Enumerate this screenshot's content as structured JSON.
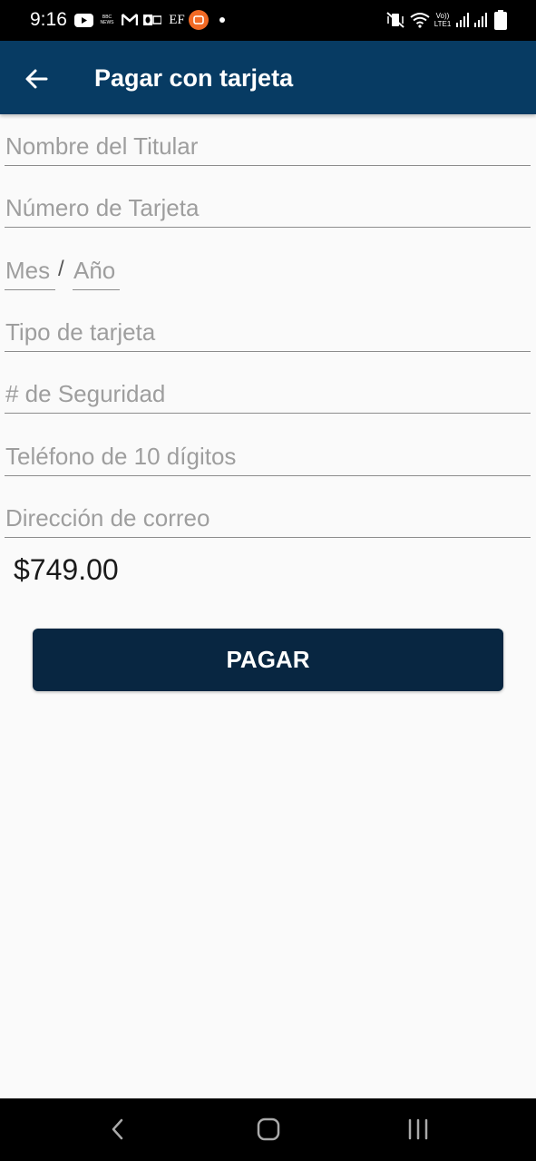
{
  "status_bar": {
    "time": "9:16",
    "icons": [
      "youtube-icon",
      "bbc-news-icon",
      "gmail-icon",
      "outlook-icon",
      "ef-icon",
      "app-notification-icon",
      "more-notifications-dot",
      "vibrate-mute-icon",
      "wifi-icon",
      "volte-icon",
      "signal-icon",
      "signal-icon-2",
      "battery-icon"
    ],
    "news_label": "BBC NEWS",
    "ef_label": "EF",
    "volte_label": "Vo)) LTE1",
    "battery_level": "7"
  },
  "app_bar": {
    "title": "Pagar con tarjeta",
    "back_icon": "arrow-back-icon"
  },
  "form": {
    "holder_name": {
      "placeholder": "Nombre del Titular",
      "value": ""
    },
    "card_number": {
      "placeholder": "Número de Tarjeta",
      "value": ""
    },
    "month": {
      "placeholder": "Mes",
      "value": ""
    },
    "separator": "/",
    "year": {
      "placeholder": "Año",
      "value": ""
    },
    "card_type": {
      "placeholder": "Tipo de tarjeta",
      "value": ""
    },
    "security_code": {
      "placeholder": "# de Seguridad",
      "value": ""
    },
    "phone": {
      "placeholder": "Teléfono de 10 dígitos",
      "value": ""
    },
    "email": {
      "placeholder": "Dirección de correo",
      "value": ""
    }
  },
  "amount": "$749.00",
  "pay_button": {
    "label": "PAGAR"
  },
  "nav_bar": {
    "back": "nav-back-icon",
    "home": "nav-home-icon",
    "recents": "nav-recents-icon"
  },
  "colors": {
    "app_bar": "#073b63",
    "button": "#082641",
    "background": "#fafafa",
    "placeholder": "#9e9e9e"
  }
}
